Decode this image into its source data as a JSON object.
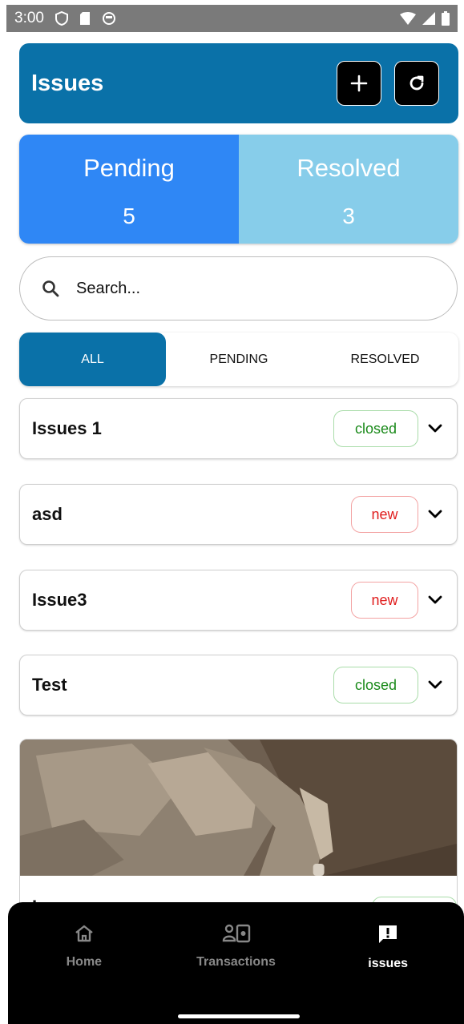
{
  "status_bar": {
    "time": "3:00"
  },
  "header": {
    "title": "Issues",
    "add_icon": "plus-icon",
    "refresh_icon": "refresh-icon"
  },
  "stats": {
    "pending_label": "Pending",
    "pending_count": "5",
    "resolved_label": "Resolved",
    "resolved_count": "3"
  },
  "search": {
    "placeholder": "Search..."
  },
  "tabs": [
    "ALL",
    "PENDING",
    "RESOLVED"
  ],
  "issues": [
    {
      "title": "Issues 1",
      "status": "closed"
    },
    {
      "title": "asd",
      "status": "new"
    },
    {
      "title": "Issue3",
      "status": "new"
    },
    {
      "title": "Test",
      "status": "closed"
    },
    {
      "title": "I",
      "status": "closed"
    }
  ],
  "nav": [
    {
      "label": "Home",
      "icon": "home-icon"
    },
    {
      "label": "Transactions",
      "icon": "transactions-icon"
    },
    {
      "label": "issues",
      "icon": "issues-icon"
    }
  ],
  "colors": {
    "primary": "#0a71a8",
    "pending": "#2f87f5",
    "resolved": "#87cdea",
    "closed": "#1a8a1a",
    "new": "#e01d1d"
  }
}
